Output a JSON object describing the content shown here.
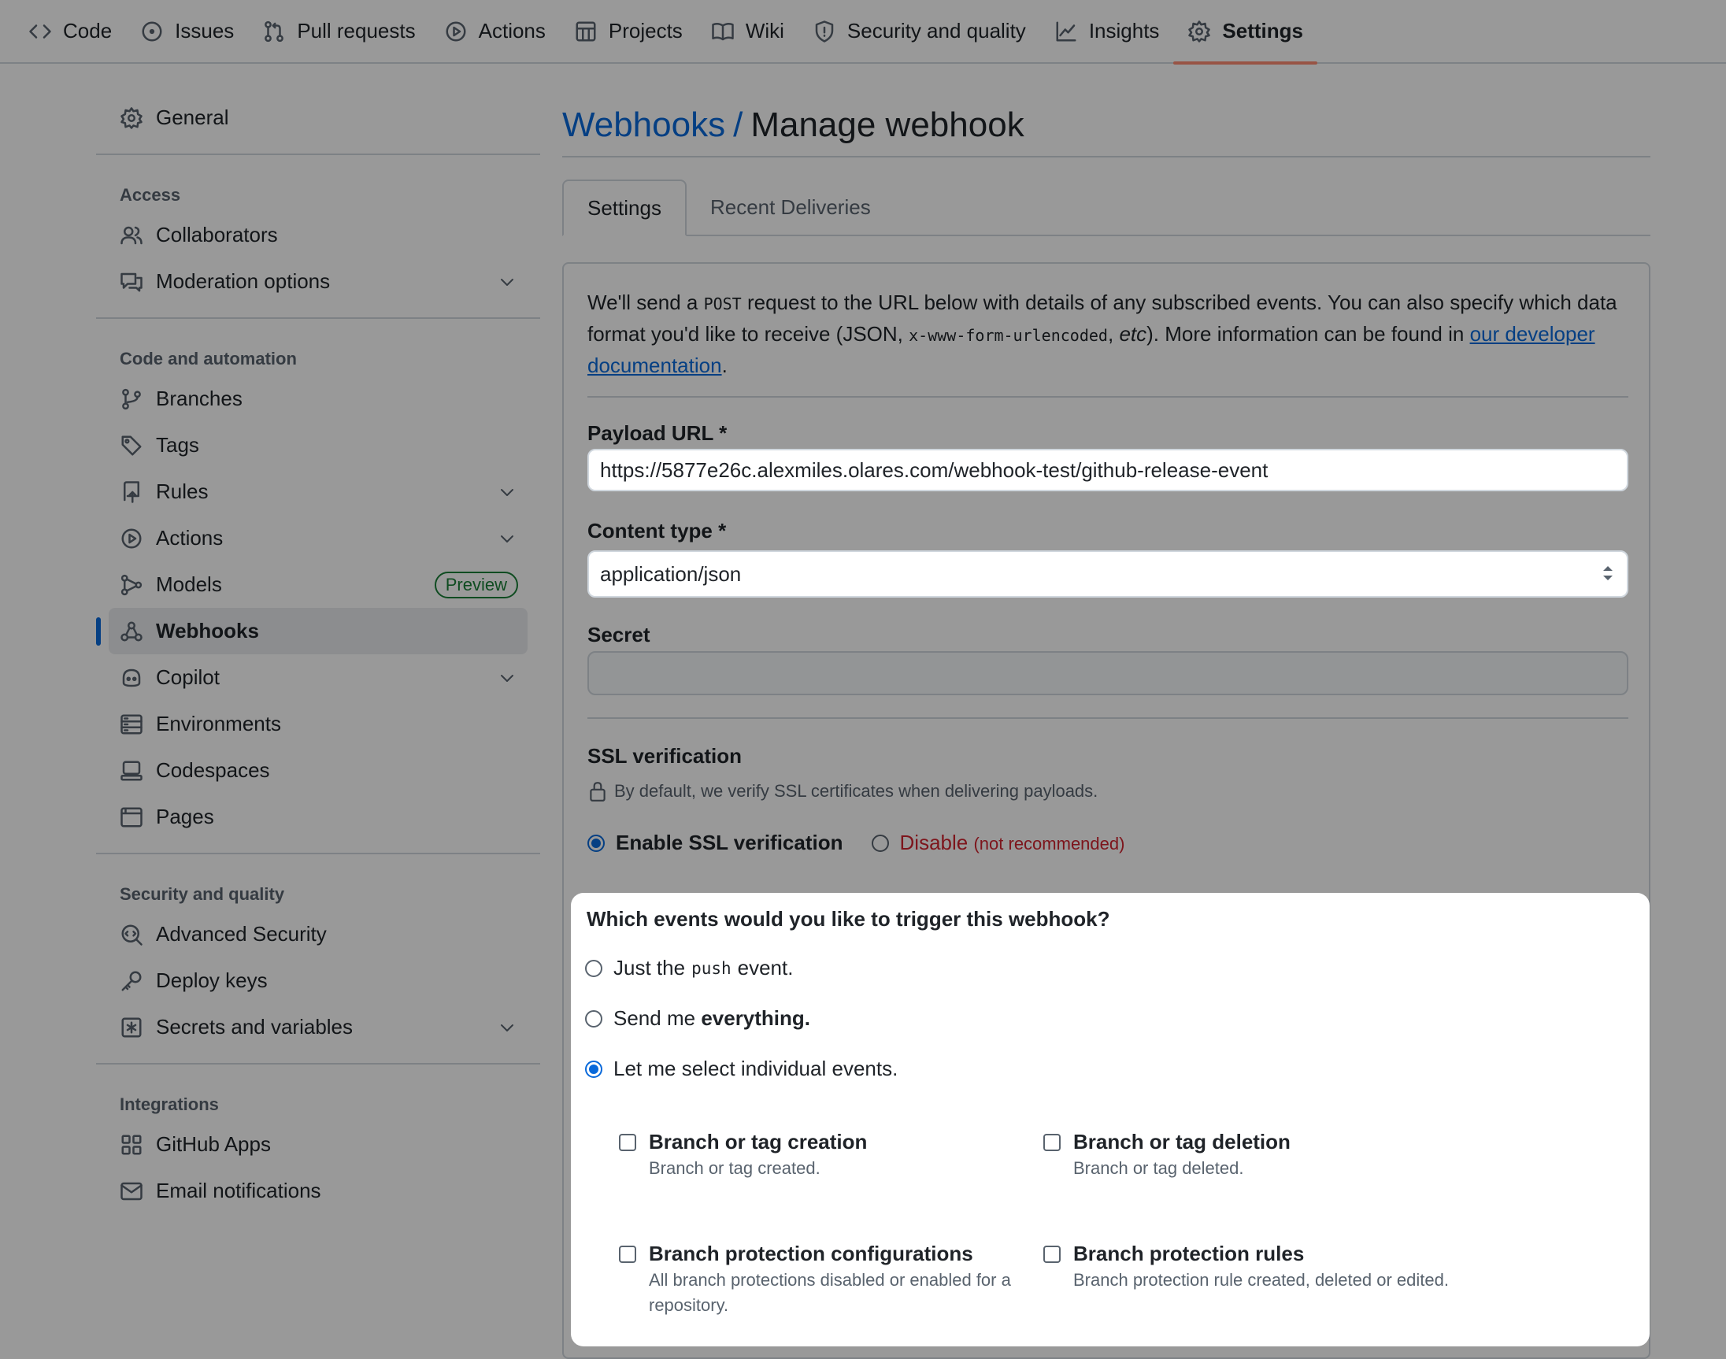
{
  "topnav": [
    {
      "label": "Code",
      "icon": "code-icon"
    },
    {
      "label": "Issues",
      "icon": "issue-icon"
    },
    {
      "label": "Pull requests",
      "icon": "pull-request-icon"
    },
    {
      "label": "Actions",
      "icon": "play-icon"
    },
    {
      "label": "Projects",
      "icon": "table-icon"
    },
    {
      "label": "Wiki",
      "icon": "book-icon"
    },
    {
      "label": "Security and quality",
      "icon": "shield-icon"
    },
    {
      "label": "Insights",
      "icon": "graph-icon"
    },
    {
      "label": "Settings",
      "icon": "gear-icon"
    }
  ],
  "sidebar": {
    "general": "General",
    "access_heading": "Access",
    "collaborators": "Collaborators",
    "moderation": "Moderation options",
    "code_heading": "Code and automation",
    "branches": "Branches",
    "tags": "Tags",
    "rules": "Rules",
    "actions": "Actions",
    "models": "Models",
    "models_badge": "Preview",
    "webhooks": "Webhooks",
    "copilot": "Copilot",
    "environments": "Environments",
    "codespaces": "Codespaces",
    "pages": "Pages",
    "security_heading": "Security and quality",
    "advanced_security": "Advanced Security",
    "deploy_keys": "Deploy keys",
    "secrets": "Secrets and variables",
    "integrations_heading": "Integrations",
    "github_apps": "GitHub Apps",
    "email_notifications": "Email notifications"
  },
  "main": {
    "breadcrumb": "Webhooks",
    "breadcrumb_sep": "/",
    "title": "Manage webhook",
    "tabs": [
      "Settings",
      "Recent Deliveries"
    ],
    "intro_1": "We'll send a ",
    "intro_code_1": "POST",
    "intro_2": " request to the URL below with details of any subscribed events. You can also specify which data format you'd like to receive (JSON, ",
    "intro_code_2": "x-www-form-urlencoded",
    "intro_3": ", ",
    "intro_etc": "etc",
    "intro_4": "). More information can be found in ",
    "intro_link": "our developer documentation",
    "intro_5": ".",
    "payload_label": "Payload URL *",
    "payload_value": "https://5877e26c.alexmiles.olares.com/webhook-test/github-release-event",
    "content_type_label": "Content type *",
    "content_type_value": "application/json",
    "secret_label": "Secret",
    "secret_value": "",
    "ssl_heading": "SSL verification",
    "ssl_desc": "By default, we verify SSL certificates when delivering payloads.",
    "ssl_enable": "Enable SSL verification",
    "ssl_disable": "Disable",
    "ssl_disable_note": "(not recommended)"
  },
  "events": {
    "title": "Which events would you like to trigger this webhook?",
    "opt_push_1": "Just the",
    "opt_push_code": "push",
    "opt_push_2": "event.",
    "opt_everything_1": "Send me",
    "opt_everything_bold": "everything.",
    "opt_individual": "Let me select individual events.",
    "selected_option": "individual",
    "items": [
      {
        "title": "Branch or tag creation",
        "desc": "Branch or tag created.",
        "checked": false
      },
      {
        "title": "Branch or tag deletion",
        "desc": "Branch or tag deleted.",
        "checked": false
      },
      {
        "title": "Branch protection configurations",
        "desc": "All branch protections disabled or enabled for a repository.",
        "checked": false
      },
      {
        "title": "Branch protection rules",
        "desc": "Branch protection rule created, deleted or edited.",
        "checked": false
      }
    ]
  },
  "colors": {
    "accent": "#0969da",
    "danger": "#d1242f",
    "success": "#1a7f37",
    "tab_underline": "#fd8c73"
  }
}
